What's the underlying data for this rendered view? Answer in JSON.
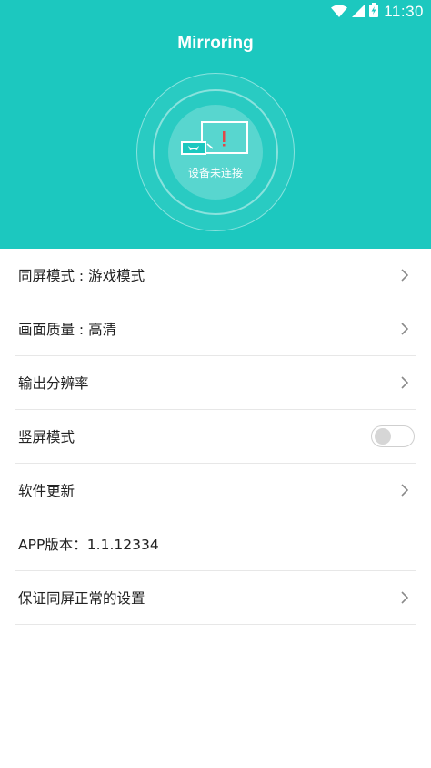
{
  "status_bar": {
    "time": "11:30",
    "icons": [
      "wifi-icon",
      "signal-icon",
      "battery-charging-icon"
    ]
  },
  "app": {
    "title": "Mirroring",
    "accent_color": "#1cc8bf"
  },
  "connection": {
    "status": "设备未连接",
    "icon": "screen-mirroring-icon"
  },
  "settings": {
    "items": [
      {
        "label": "同屏模式 : 游戏模式",
        "control": "chevron"
      },
      {
        "label": "画面质量 : 高清",
        "control": "chevron"
      },
      {
        "label": "输出分辨率",
        "control": "chevron"
      },
      {
        "label": "竖屏模式",
        "control": "toggle",
        "toggle_on": false
      },
      {
        "label": "软件更新",
        "control": "chevron"
      },
      {
        "label": "APP版本：1.1.12334",
        "control": "none"
      },
      {
        "label": "保证同屏正常的设置",
        "control": "chevron"
      }
    ]
  }
}
